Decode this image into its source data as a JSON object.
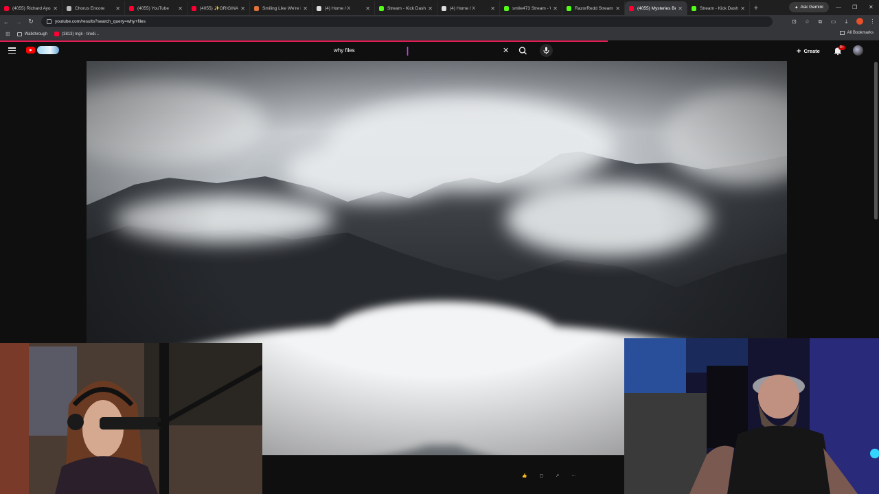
{
  "browser": {
    "tabs": [
      {
        "title": "(4055) Richard Ayoa",
        "fav": "#ff0033"
      },
      {
        "title": "Chorus Encore",
        "fav": "#bbbbbb"
      },
      {
        "title": "(4055) YouTube",
        "fav": "#ff0033"
      },
      {
        "title": "(4055) ✨ORIGINAL",
        "fav": "#ff0033"
      },
      {
        "title": "Smiling Like We're F",
        "fav": "#e0733a"
      },
      {
        "title": "(4) Home / X",
        "fav": "#dddddd"
      },
      {
        "title": "Stream - Kick Dashb",
        "fav": "#53fc18"
      },
      {
        "title": "(4) Home / X",
        "fav": "#dddddd"
      },
      {
        "title": "smile473 Stream - W",
        "fav": "#53fc18"
      },
      {
        "title": "RazorRedd Stream -",
        "fav": "#53fc18"
      },
      {
        "title": "(4055) Mysteries Ben",
        "fav": "#ff0033",
        "active": true
      },
      {
        "title": "Stream - Kick Dashb",
        "fav": "#53fc18"
      }
    ],
    "new_tab": "+",
    "ask_gemini": "Ask Gemini",
    "url": "youtube.com/results?search_query=why+files",
    "bookmarks": [
      {
        "label": "Walkthrough"
      },
      {
        "label": "(3813) mgk - tiredi..."
      }
    ],
    "all_bookmarks": "All Bookmarks"
  },
  "youtube": {
    "search_value": "why files",
    "create_label": "Create",
    "notif_badge": "9+",
    "accent": "#ff0000"
  }
}
